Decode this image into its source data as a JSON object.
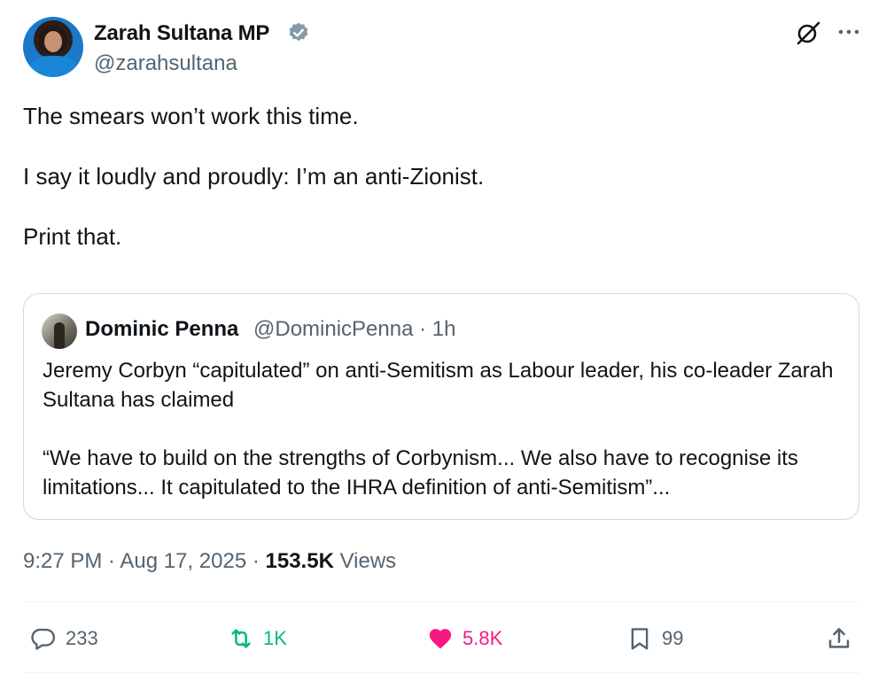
{
  "author": {
    "name": "Zarah Sultana MP",
    "handle": "@zarahsultana"
  },
  "tweet": {
    "text": "The smears won’t work this time.\n\nI say it loudly and proudly: I’m an anti-Zionist.\n\nPrint that."
  },
  "quote": {
    "name": "Dominic Penna",
    "handle_time": "@DominicPenna · 1h",
    "text": "Jeremy Corbyn “capitulated” on anti-Semitism as Labour leader, his co-leader Zarah Sultana has claimed\n\n“We have to build on the strengths of Corbynism... We also have to recognise its limitations... It capitulated to the IHRA definition of anti-Semitism”..."
  },
  "meta": {
    "time": "9:27 PM · Aug 17, 2025 · ",
    "views_count": "153.5K",
    "views_label": "Views"
  },
  "actions": {
    "replies": "233",
    "reposts": "1K",
    "likes": "5.8K",
    "bookmarks": "99"
  },
  "colors": {
    "repost": "#00ba7c",
    "like": "#f91880",
    "muted": "#536471",
    "verified": "#829aab"
  },
  "icons": [
    "verified-badge-icon",
    "grok-icon",
    "more-icon",
    "reply-icon",
    "repost-icon",
    "like-icon",
    "bookmark-icon",
    "share-icon"
  ]
}
